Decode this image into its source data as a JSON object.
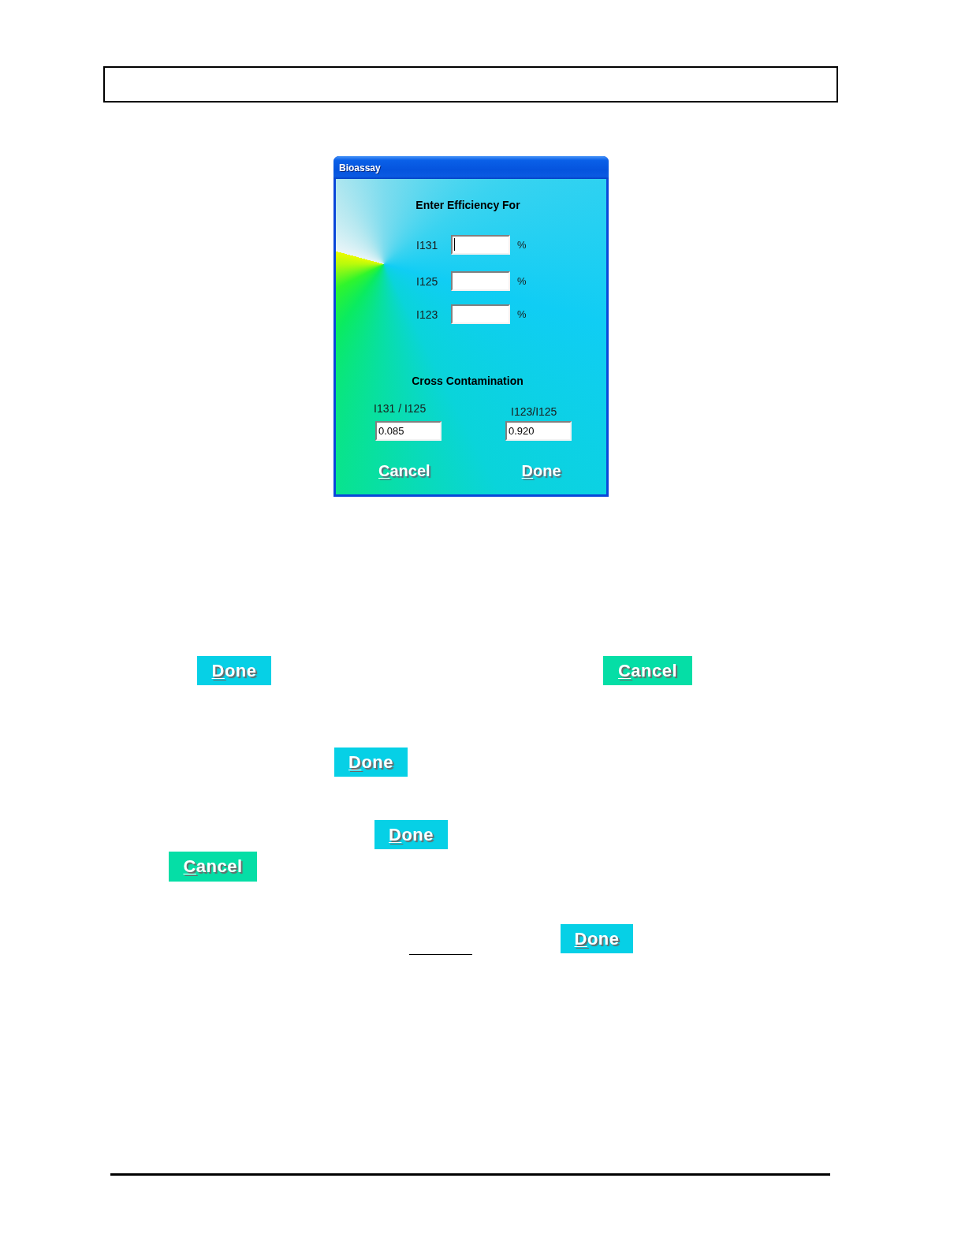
{
  "dialog": {
    "title": "Bioassay",
    "efficiency": {
      "heading": "Enter Efficiency For",
      "rows": [
        {
          "label": "I131",
          "unit": "%",
          "focused": true
        },
        {
          "label": "I125",
          "unit": "%",
          "focused": false
        },
        {
          "label": "I123",
          "unit": "%",
          "focused": false
        }
      ]
    },
    "cross_contamination": {
      "heading": "Cross Contamination",
      "fields": [
        {
          "label": "I131 / I125",
          "value": "0.085"
        },
        {
          "label": "I123/I125",
          "value": "0.920"
        }
      ]
    },
    "buttons": [
      {
        "label": "Cancel"
      },
      {
        "label": "Done"
      }
    ]
  },
  "document": {
    "button_rows": [
      {
        "buttons": [
          {
            "label": "Done",
            "color": "#06d0e6"
          },
          {
            "label": "Cancel",
            "color": "#05dea6"
          }
        ]
      },
      {
        "buttons": [
          {
            "label": "Done",
            "color": "#06d0e6"
          }
        ]
      },
      {
        "buttons": [
          {
            "label": "Done",
            "color": "#06d0e6"
          }
        ]
      },
      {
        "buttons": [
          {
            "label": "Cancel",
            "color": "#05dea6"
          }
        ]
      },
      {
        "buttons": [
          {
            "label": "Done",
            "color": "#06d0e6"
          }
        ]
      }
    ]
  }
}
